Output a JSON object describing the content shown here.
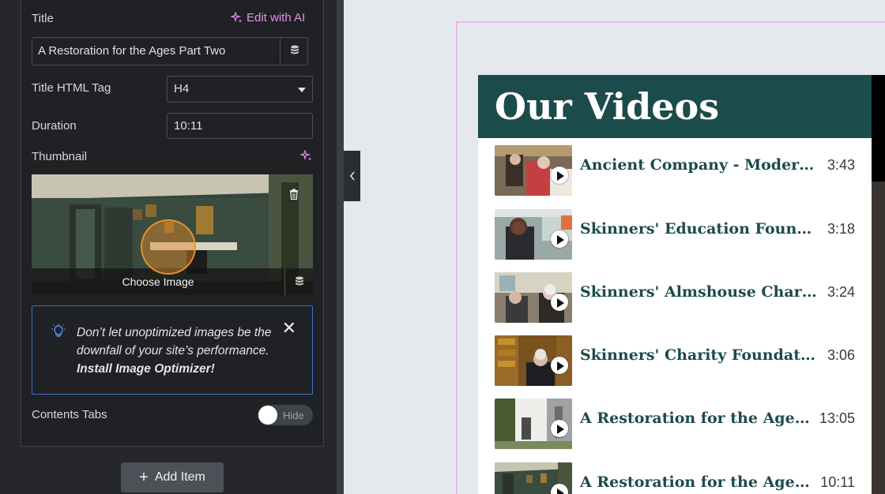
{
  "editor": {
    "title_label": "Title",
    "edit_ai_label": "Edit with AI",
    "title_value": "A Restoration for the Ages Part Two",
    "title_tag_label": "Title HTML Tag",
    "title_tag_value": "H4",
    "duration_label": "Duration",
    "duration_value": "10:11",
    "thumbnail_label": "Thumbnail",
    "choose_image_label": "Choose Image",
    "notice": {
      "line1": "Don’t let unoptimized images be the downfall of your site’s performance.",
      "cta": "Install Image Optimizer!"
    },
    "contents_tabs_label": "Contents Tabs",
    "toggle_label": "Hide",
    "add_item_label": "Add Item"
  },
  "preview": {
    "heading": "Our Videos",
    "videos": [
      {
        "title": "Ancient Company - Modern Mission",
        "duration": "3:43"
      },
      {
        "title": "Skinners' Education Foundation",
        "duration": "3:18"
      },
      {
        "title": "Skinners' Almshouse Charity",
        "duration": "3:24"
      },
      {
        "title": "Skinners' Charity Foundation",
        "duration": "3:06"
      },
      {
        "title": "A Restoration for the Ages Part One",
        "duration": "13:05"
      },
      {
        "title": "A Restoration for the Ages Part Two",
        "duration": "10:11"
      }
    ]
  },
  "colors": {
    "accent_pink": "#e78df0",
    "brand_teal": "#1c4b4c",
    "notice_border": "#3a74c9"
  }
}
